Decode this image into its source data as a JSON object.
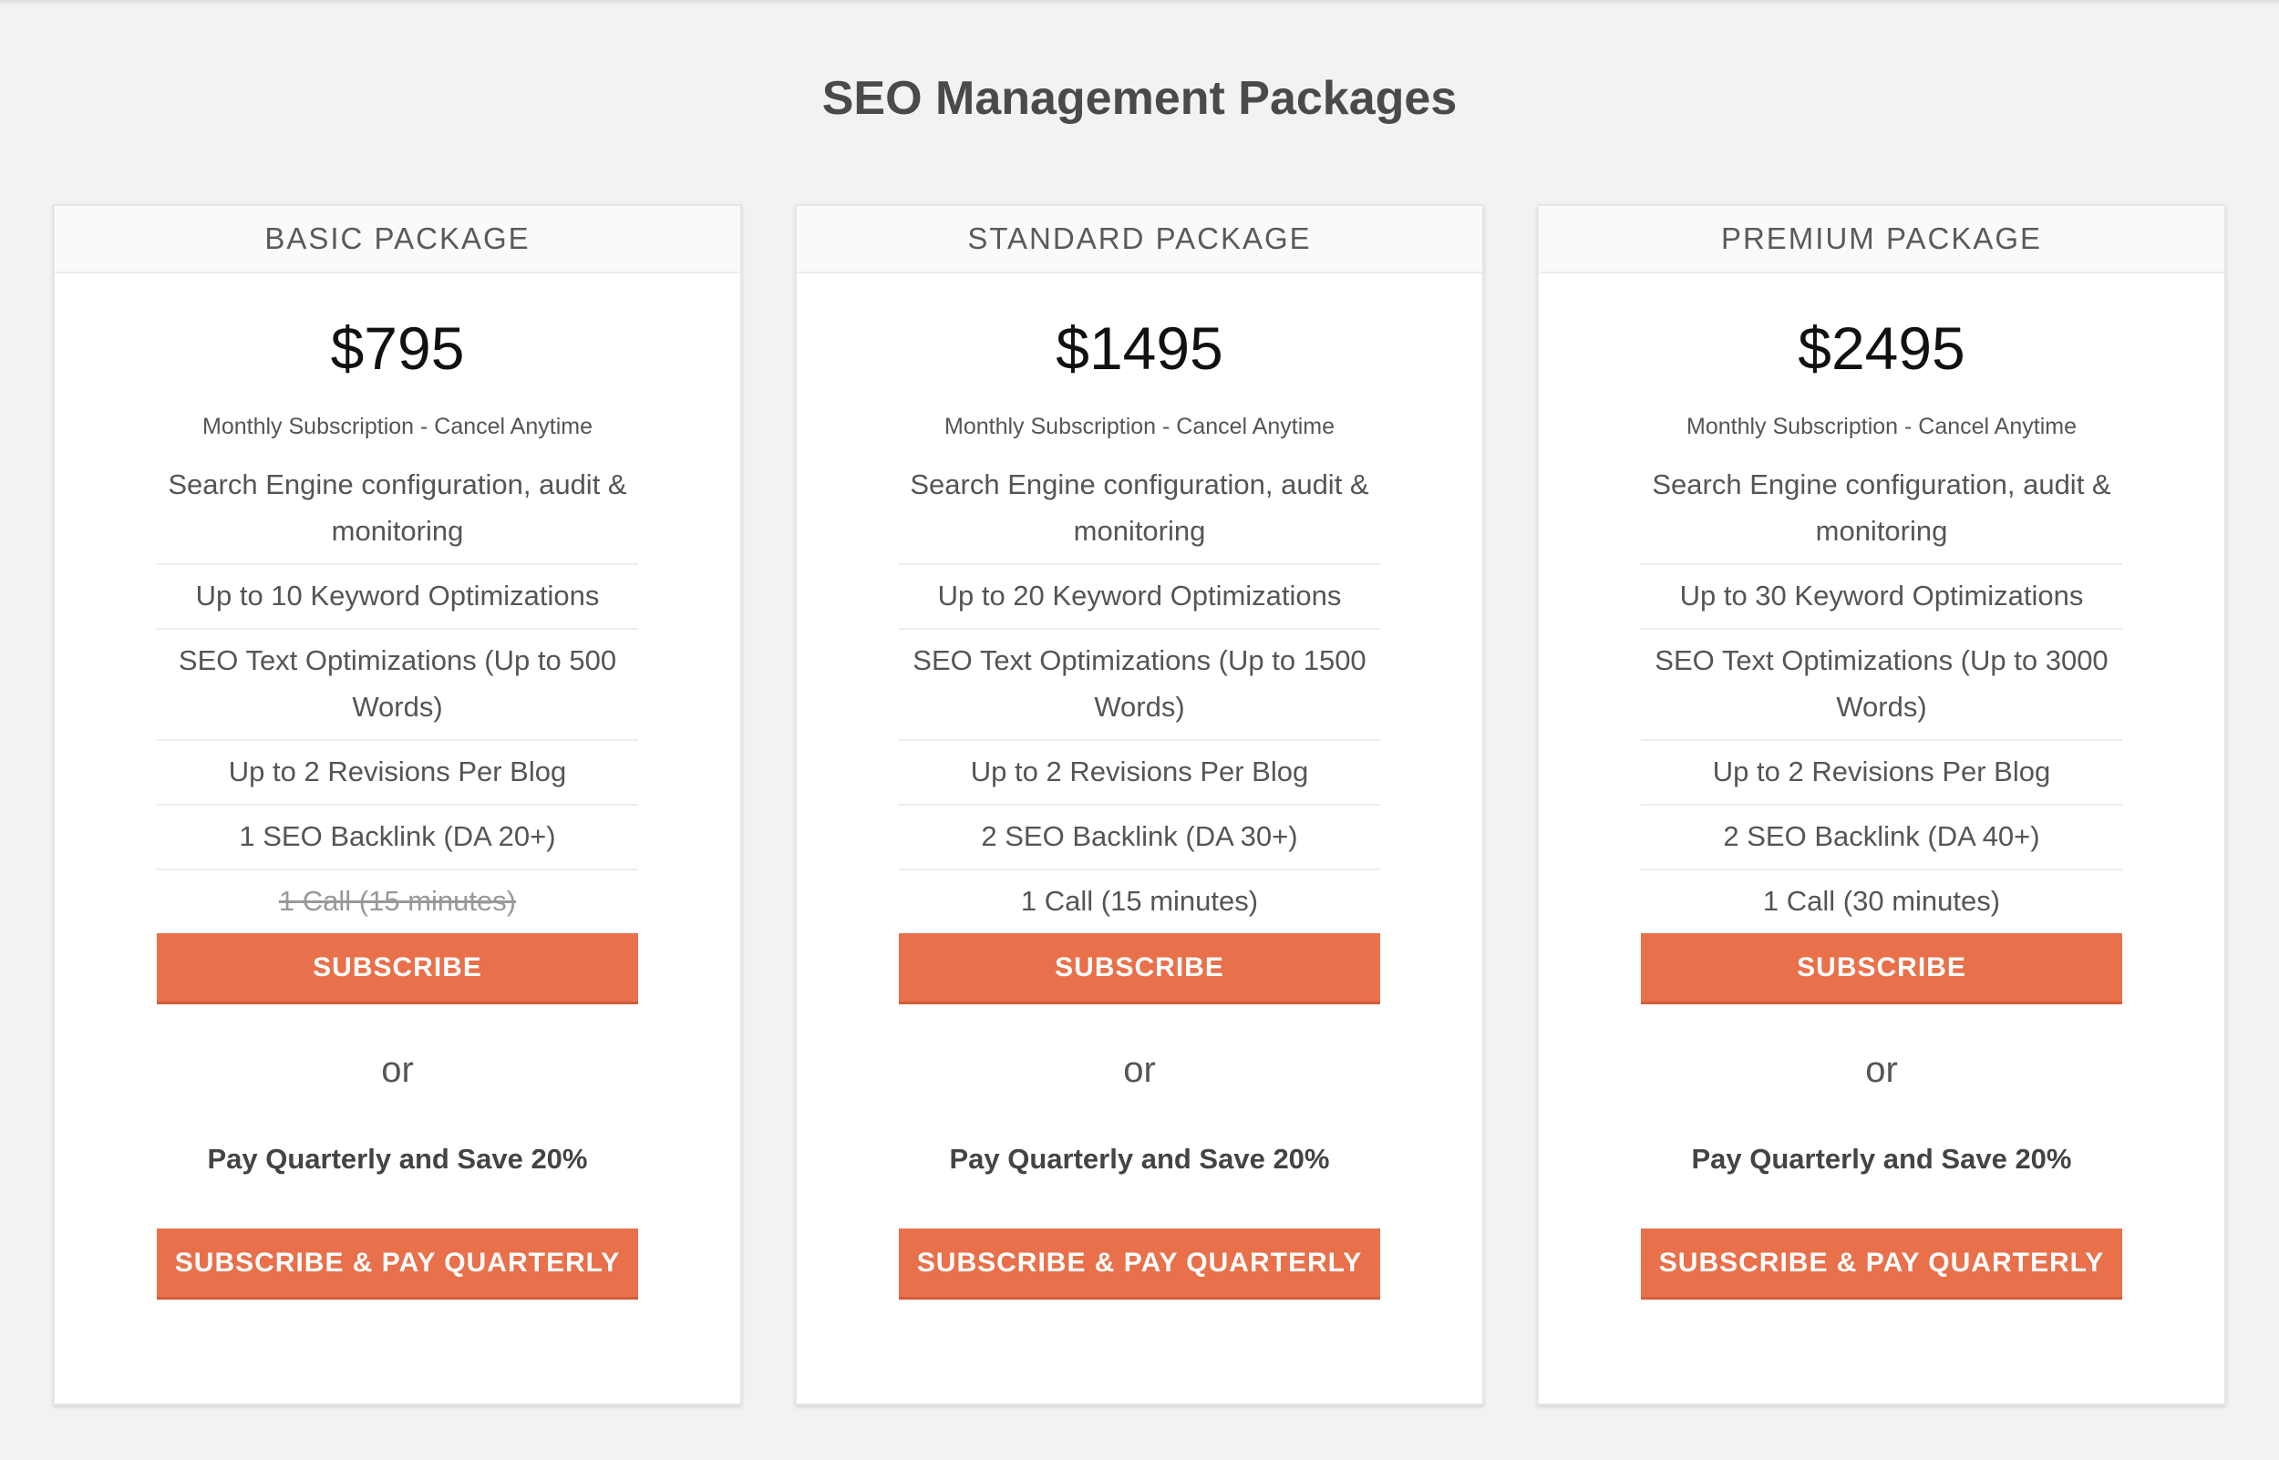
{
  "page": {
    "title": "SEO Management Packages"
  },
  "packages": [
    {
      "name": "BASIC PACKAGE",
      "price": "$795",
      "subtitle": "Monthly Subscription - Cancel Anytime",
      "features": [
        {
          "text": "Search Engine configuration, audit & monitoring",
          "included": true
        },
        {
          "text": "Up to 10 Keyword Optimizations",
          "included": true
        },
        {
          "text": "SEO Text Optimizations (Up to 500 Words)",
          "included": true
        },
        {
          "text": "Up to 2 Revisions Per Blog",
          "included": true
        },
        {
          "text": "1 SEO Backlink (DA 20+)",
          "included": true
        },
        {
          "text": "1 Call (15 minutes)",
          "included": false
        }
      ],
      "subscribe_label": "SUBSCRIBE",
      "or_label": "or",
      "quarterly_text": "Pay Quarterly and Save 20%",
      "quarterly_button_label": "SUBSCRIBE & PAY QUARTERLY"
    },
    {
      "name": "STANDARD PACKAGE",
      "price": "$1495",
      "subtitle": "Monthly Subscription - Cancel Anytime",
      "features": [
        {
          "text": "Search Engine configuration, audit & monitoring",
          "included": true
        },
        {
          "text": "Up to 20 Keyword Optimizations",
          "included": true
        },
        {
          "text": "SEO Text Optimizations (Up to 1500 Words)",
          "included": true
        },
        {
          "text": "Up to 2 Revisions Per Blog",
          "included": true
        },
        {
          "text": "2 SEO Backlink (DA 30+)",
          "included": true
        },
        {
          "text": "1 Call (15 minutes)",
          "included": true
        }
      ],
      "subscribe_label": "SUBSCRIBE",
      "or_label": "or",
      "quarterly_text": "Pay Quarterly and Save 20%",
      "quarterly_button_label": "SUBSCRIBE & PAY QUARTERLY"
    },
    {
      "name": "PREMIUM PACKAGE",
      "price": "$2495",
      "subtitle": "Monthly Subscription - Cancel Anytime",
      "features": [
        {
          "text": "Search Engine configuration, audit & monitoring",
          "included": true
        },
        {
          "text": "Up to 30 Keyword Optimizations",
          "included": true
        },
        {
          "text": "SEO Text Optimizations (Up to 3000 Words)",
          "included": true
        },
        {
          "text": "Up to 2 Revisions Per Blog",
          "included": true
        },
        {
          "text": "2 SEO Backlink (DA 40+)",
          "included": true
        },
        {
          "text": "1 Call (30 minutes)",
          "included": true
        }
      ],
      "subscribe_label": "SUBSCRIBE",
      "or_label": "or",
      "quarterly_text": "Pay Quarterly and Save 20%",
      "quarterly_button_label": "SUBSCRIBE & PAY QUARTERLY"
    }
  ],
  "colors": {
    "background": "#f2f2f2",
    "card": "#ffffff",
    "button": "#e8704a",
    "button_text": "#ffffff",
    "price_text": "#111111"
  }
}
